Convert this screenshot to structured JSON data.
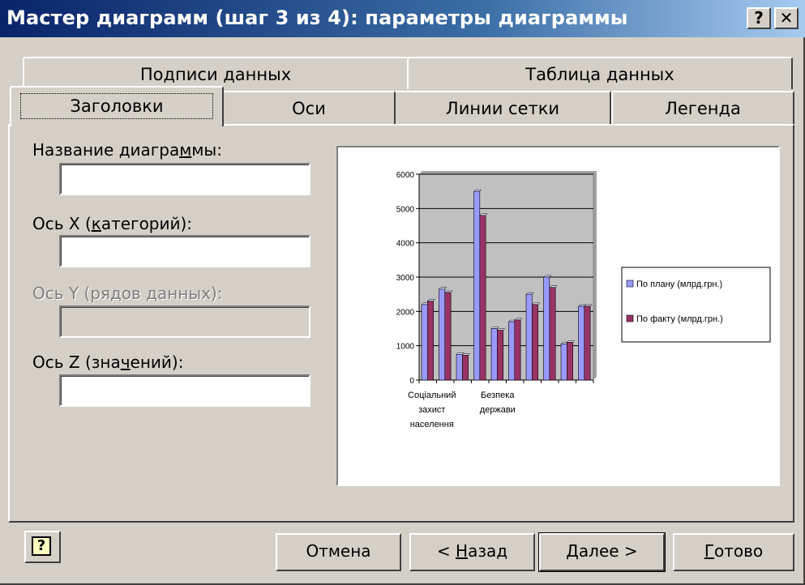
{
  "window": {
    "title": "Мастер диаграмм (шаг 3 из 4): параметры диаграммы",
    "help_button": "?",
    "close_button": "✕"
  },
  "tabs": {
    "back_row": [
      "Подписи данных",
      "Таблица данных"
    ],
    "front_row": [
      "Заголовки",
      "Оси",
      "Линии сетки",
      "Легенда"
    ],
    "active": "Заголовки"
  },
  "fields": {
    "chart_title_pre": "Название диагра",
    "chart_title_u": "м",
    "chart_title_post": "мы:",
    "x_axis_pre": "Ось X (",
    "x_axis_u": "к",
    "x_axis_post": "атегорий):",
    "y_axis_label": "Ось Y (рядов данных):",
    "z_axis_pre": "Ось Z (зна",
    "z_axis_u": "ч",
    "z_axis_post": "ений):",
    "chart_title_value": "",
    "x_axis_value": "",
    "y_axis_value": "",
    "z_axis_value": ""
  },
  "buttons": {
    "help_icon": "?",
    "cancel": "Отмена",
    "back_pre": "< ",
    "back_u": "Н",
    "back_post": "азад",
    "next": "Далее >",
    "finish_u": "Г",
    "finish_post": "отово"
  },
  "chart_data": {
    "type": "bar",
    "categories": [
      "Соціальний захист населення",
      "",
      "",
      "",
      "Безпека держави",
      "",
      "",
      "",
      "",
      ""
    ],
    "category_labels": [
      {
        "lines": [
          "Соціальний",
          "захист",
          "населення"
        ]
      },
      {
        "lines": [
          "Безпека",
          "держави"
        ]
      }
    ],
    "series": [
      {
        "name": "По плану (млрд.грн.)",
        "color": "#9999ff",
        "values": [
          2200,
          2650,
          750,
          5500,
          1500,
          1700,
          2500,
          3000,
          1050,
          2150
        ]
      },
      {
        "name": "По факту (млрд.грн.)",
        "color": "#993366",
        "values": [
          2300,
          2550,
          720,
          4800,
          1450,
          1750,
          2200,
          2700,
          1100,
          2150
        ]
      }
    ],
    "ylim": [
      0,
      6000
    ],
    "yticks": [
      0,
      1000,
      2000,
      3000,
      4000,
      5000,
      6000
    ],
    "grid": true,
    "plot_background": "#c0c0c0",
    "legend_position": "right"
  }
}
